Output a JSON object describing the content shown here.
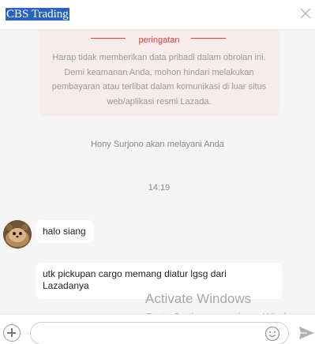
{
  "header": {
    "title": "CBS Trading"
  },
  "warning": {
    "title": "peringatan",
    "text": "Harap tidak memberikan data pribadi dalam obrolan ini. Demi keamanan Anda, mohon hindari melakukan pembayaran atau terlibat dalam komunikasi di luar situs web/aplikasi resmi Lazada."
  },
  "system_message": "Hony Surjono akan melayani Anda",
  "timestamp": "14:19",
  "messages": [
    {
      "sender": "seller",
      "text": "halo siang"
    },
    {
      "sender": "seller",
      "text": "utk pickupan cargo memang diatur lgsg dari Lazadanya"
    }
  ],
  "watermark": {
    "title": "Activate Windows",
    "subtitle": "Go to Settings to activate Windows."
  },
  "input": {
    "value": "",
    "placeholder": ""
  },
  "icons": {
    "close": "close-icon",
    "add": "plus-circle-icon",
    "emoji": "smiley-icon",
    "send": "send-arrow-icon"
  },
  "colors": {
    "title_highlight": "#2a62c4",
    "warning_accent": "#e0423c",
    "warning_bg": "#f7ebeb",
    "chat_bg": "#f5f5f5"
  }
}
